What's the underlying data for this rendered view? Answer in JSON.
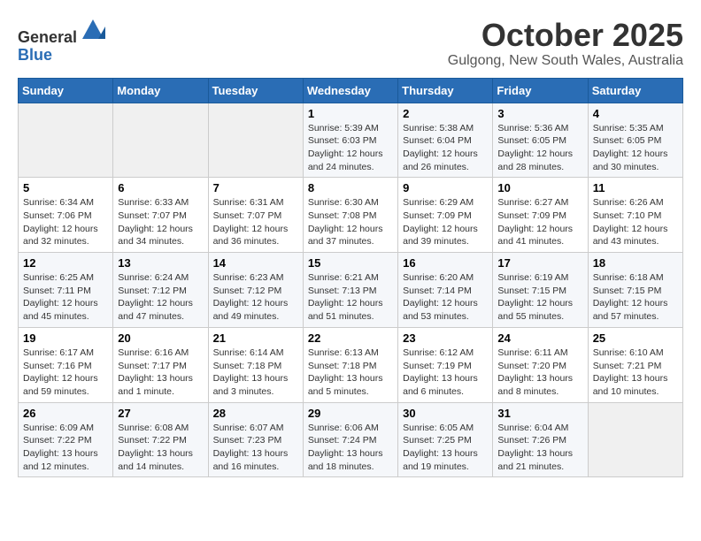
{
  "header": {
    "logo_line1": "General",
    "logo_line2": "Blue",
    "month_title": "October 2025",
    "location": "Gulgong, New South Wales, Australia"
  },
  "weekdays": [
    "Sunday",
    "Monday",
    "Tuesday",
    "Wednesday",
    "Thursday",
    "Friday",
    "Saturday"
  ],
  "weeks": [
    [
      {
        "day": "",
        "info": ""
      },
      {
        "day": "",
        "info": ""
      },
      {
        "day": "",
        "info": ""
      },
      {
        "day": "1",
        "info": "Sunrise: 5:39 AM\nSunset: 6:03 PM\nDaylight: 12 hours\nand 24 minutes."
      },
      {
        "day": "2",
        "info": "Sunrise: 5:38 AM\nSunset: 6:04 PM\nDaylight: 12 hours\nand 26 minutes."
      },
      {
        "day": "3",
        "info": "Sunrise: 5:36 AM\nSunset: 6:05 PM\nDaylight: 12 hours\nand 28 minutes."
      },
      {
        "day": "4",
        "info": "Sunrise: 5:35 AM\nSunset: 6:05 PM\nDaylight: 12 hours\nand 30 minutes."
      }
    ],
    [
      {
        "day": "5",
        "info": "Sunrise: 6:34 AM\nSunset: 7:06 PM\nDaylight: 12 hours\nand 32 minutes."
      },
      {
        "day": "6",
        "info": "Sunrise: 6:33 AM\nSunset: 7:07 PM\nDaylight: 12 hours\nand 34 minutes."
      },
      {
        "day": "7",
        "info": "Sunrise: 6:31 AM\nSunset: 7:07 PM\nDaylight: 12 hours\nand 36 minutes."
      },
      {
        "day": "8",
        "info": "Sunrise: 6:30 AM\nSunset: 7:08 PM\nDaylight: 12 hours\nand 37 minutes."
      },
      {
        "day": "9",
        "info": "Sunrise: 6:29 AM\nSunset: 7:09 PM\nDaylight: 12 hours\nand 39 minutes."
      },
      {
        "day": "10",
        "info": "Sunrise: 6:27 AM\nSunset: 7:09 PM\nDaylight: 12 hours\nand 41 minutes."
      },
      {
        "day": "11",
        "info": "Sunrise: 6:26 AM\nSunset: 7:10 PM\nDaylight: 12 hours\nand 43 minutes."
      }
    ],
    [
      {
        "day": "12",
        "info": "Sunrise: 6:25 AM\nSunset: 7:11 PM\nDaylight: 12 hours\nand 45 minutes."
      },
      {
        "day": "13",
        "info": "Sunrise: 6:24 AM\nSunset: 7:12 PM\nDaylight: 12 hours\nand 47 minutes."
      },
      {
        "day": "14",
        "info": "Sunrise: 6:23 AM\nSunset: 7:12 PM\nDaylight: 12 hours\nand 49 minutes."
      },
      {
        "day": "15",
        "info": "Sunrise: 6:21 AM\nSunset: 7:13 PM\nDaylight: 12 hours\nand 51 minutes."
      },
      {
        "day": "16",
        "info": "Sunrise: 6:20 AM\nSunset: 7:14 PM\nDaylight: 12 hours\nand 53 minutes."
      },
      {
        "day": "17",
        "info": "Sunrise: 6:19 AM\nSunset: 7:15 PM\nDaylight: 12 hours\nand 55 minutes."
      },
      {
        "day": "18",
        "info": "Sunrise: 6:18 AM\nSunset: 7:15 PM\nDaylight: 12 hours\nand 57 minutes."
      }
    ],
    [
      {
        "day": "19",
        "info": "Sunrise: 6:17 AM\nSunset: 7:16 PM\nDaylight: 12 hours\nand 59 minutes."
      },
      {
        "day": "20",
        "info": "Sunrise: 6:16 AM\nSunset: 7:17 PM\nDaylight: 13 hours\nand 1 minute."
      },
      {
        "day": "21",
        "info": "Sunrise: 6:14 AM\nSunset: 7:18 PM\nDaylight: 13 hours\nand 3 minutes."
      },
      {
        "day": "22",
        "info": "Sunrise: 6:13 AM\nSunset: 7:18 PM\nDaylight: 13 hours\nand 5 minutes."
      },
      {
        "day": "23",
        "info": "Sunrise: 6:12 AM\nSunset: 7:19 PM\nDaylight: 13 hours\nand 6 minutes."
      },
      {
        "day": "24",
        "info": "Sunrise: 6:11 AM\nSunset: 7:20 PM\nDaylight: 13 hours\nand 8 minutes."
      },
      {
        "day": "25",
        "info": "Sunrise: 6:10 AM\nSunset: 7:21 PM\nDaylight: 13 hours\nand 10 minutes."
      }
    ],
    [
      {
        "day": "26",
        "info": "Sunrise: 6:09 AM\nSunset: 7:22 PM\nDaylight: 13 hours\nand 12 minutes."
      },
      {
        "day": "27",
        "info": "Sunrise: 6:08 AM\nSunset: 7:22 PM\nDaylight: 13 hours\nand 14 minutes."
      },
      {
        "day": "28",
        "info": "Sunrise: 6:07 AM\nSunset: 7:23 PM\nDaylight: 13 hours\nand 16 minutes."
      },
      {
        "day": "29",
        "info": "Sunrise: 6:06 AM\nSunset: 7:24 PM\nDaylight: 13 hours\nand 18 minutes."
      },
      {
        "day": "30",
        "info": "Sunrise: 6:05 AM\nSunset: 7:25 PM\nDaylight: 13 hours\nand 19 minutes."
      },
      {
        "day": "31",
        "info": "Sunrise: 6:04 AM\nSunset: 7:26 PM\nDaylight: 13 hours\nand 21 minutes."
      },
      {
        "day": "",
        "info": ""
      }
    ]
  ]
}
